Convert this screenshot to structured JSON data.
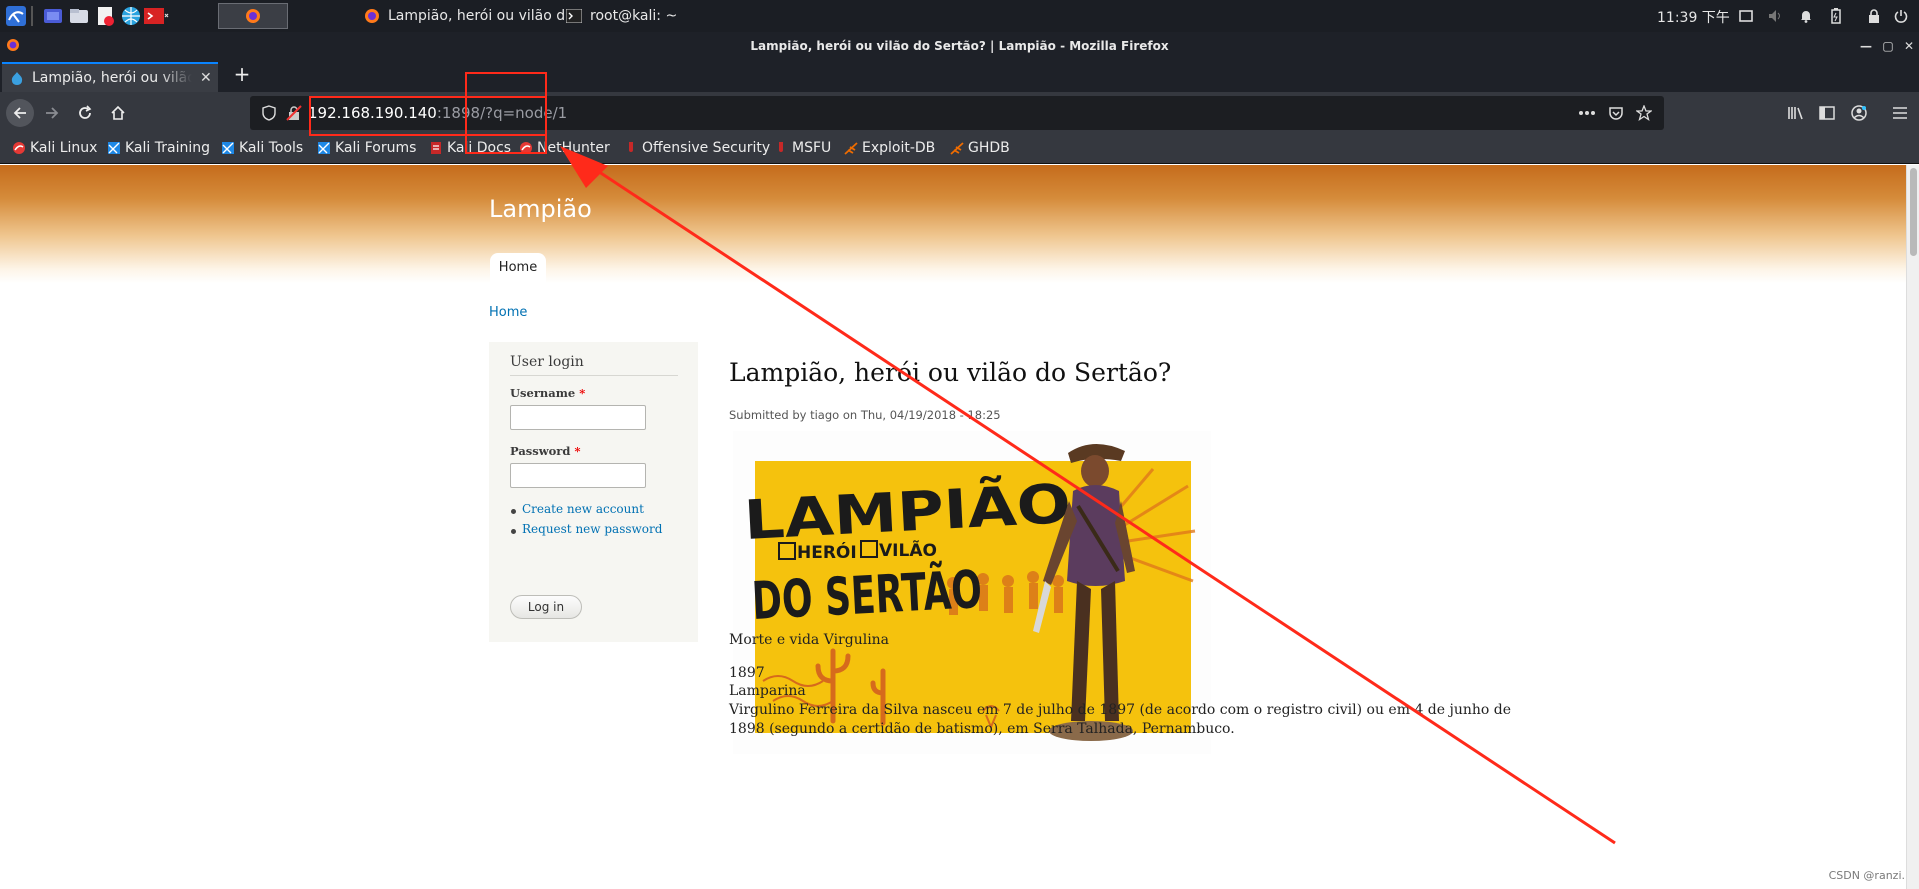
{
  "panel": {
    "tasks": [
      {
        "label": "Lampião, herói ou vilão d...",
        "icon": "firefox-icon"
      },
      {
        "label": "root@kali: ~",
        "icon": "terminal-icon"
      }
    ],
    "clock": "11:39 下午"
  },
  "window": {
    "title": "Lampião, herói ou vilão do Sertão? | Lampião - Mozilla Firefox"
  },
  "tab": {
    "label": "Lampião, herói ou vilão do Sertão? | Lampião",
    "close": "✕"
  },
  "url": {
    "host": "192.168.190.140",
    "port": ":1898",
    "query": "/?q=node/1"
  },
  "bookmarks": [
    {
      "label": "Kali Linux",
      "color": "#e53935"
    },
    {
      "label": "Kali Training",
      "color": "#1e88e5"
    },
    {
      "label": "Kali Tools",
      "color": "#1e88e5"
    },
    {
      "label": "Kali Forums",
      "color": "#1e88e5"
    },
    {
      "label": "Kali Docs",
      "color": "#c62828"
    },
    {
      "label": "NetHunter",
      "color": "#e53935"
    },
    {
      "label": "Offensive Security",
      "color": "#c62828"
    },
    {
      "label": "MSFU",
      "color": "#c62828"
    },
    {
      "label": "Exploit-DB",
      "color": "#ef6c00"
    },
    {
      "label": "GHDB",
      "color": "#ef6c00"
    }
  ],
  "site": {
    "name": "Lampião",
    "nav_home": "Home",
    "breadcrumb": "Home"
  },
  "login": {
    "title": "User login",
    "username_label": "Username",
    "password_label": "Password",
    "required": "*",
    "links": [
      "Create new account",
      "Request new password"
    ],
    "button": "Log in"
  },
  "node": {
    "title": "Lampião, herói ou vilão do Sertão?",
    "submitted": "Submitted by tiago on Thu, 04/19/2018 - 18:25",
    "poster": {
      "line1": "LAMPIÃO,",
      "opt1": "HERÓI",
      "opt2": "VILÃO",
      "line3": "DO SERTÃO"
    },
    "paragraphs": [
      "Morte e vida Virgulina",
      "1897",
      "Lamparina",
      "Virgulino Ferreira da Silva nasceu em 7 de julho de 1897 (de acordo com o registro civil) ou em 4 de junho de",
      "1898 (segundo a certidão de batismo), em Serra Talhada, Pernambuco."
    ]
  },
  "watermark": "CSDN @ranzi.",
  "colors": {
    "annotation": "#ff2a1a",
    "link": "#0071b3",
    "header_top": "#c56c1c"
  }
}
